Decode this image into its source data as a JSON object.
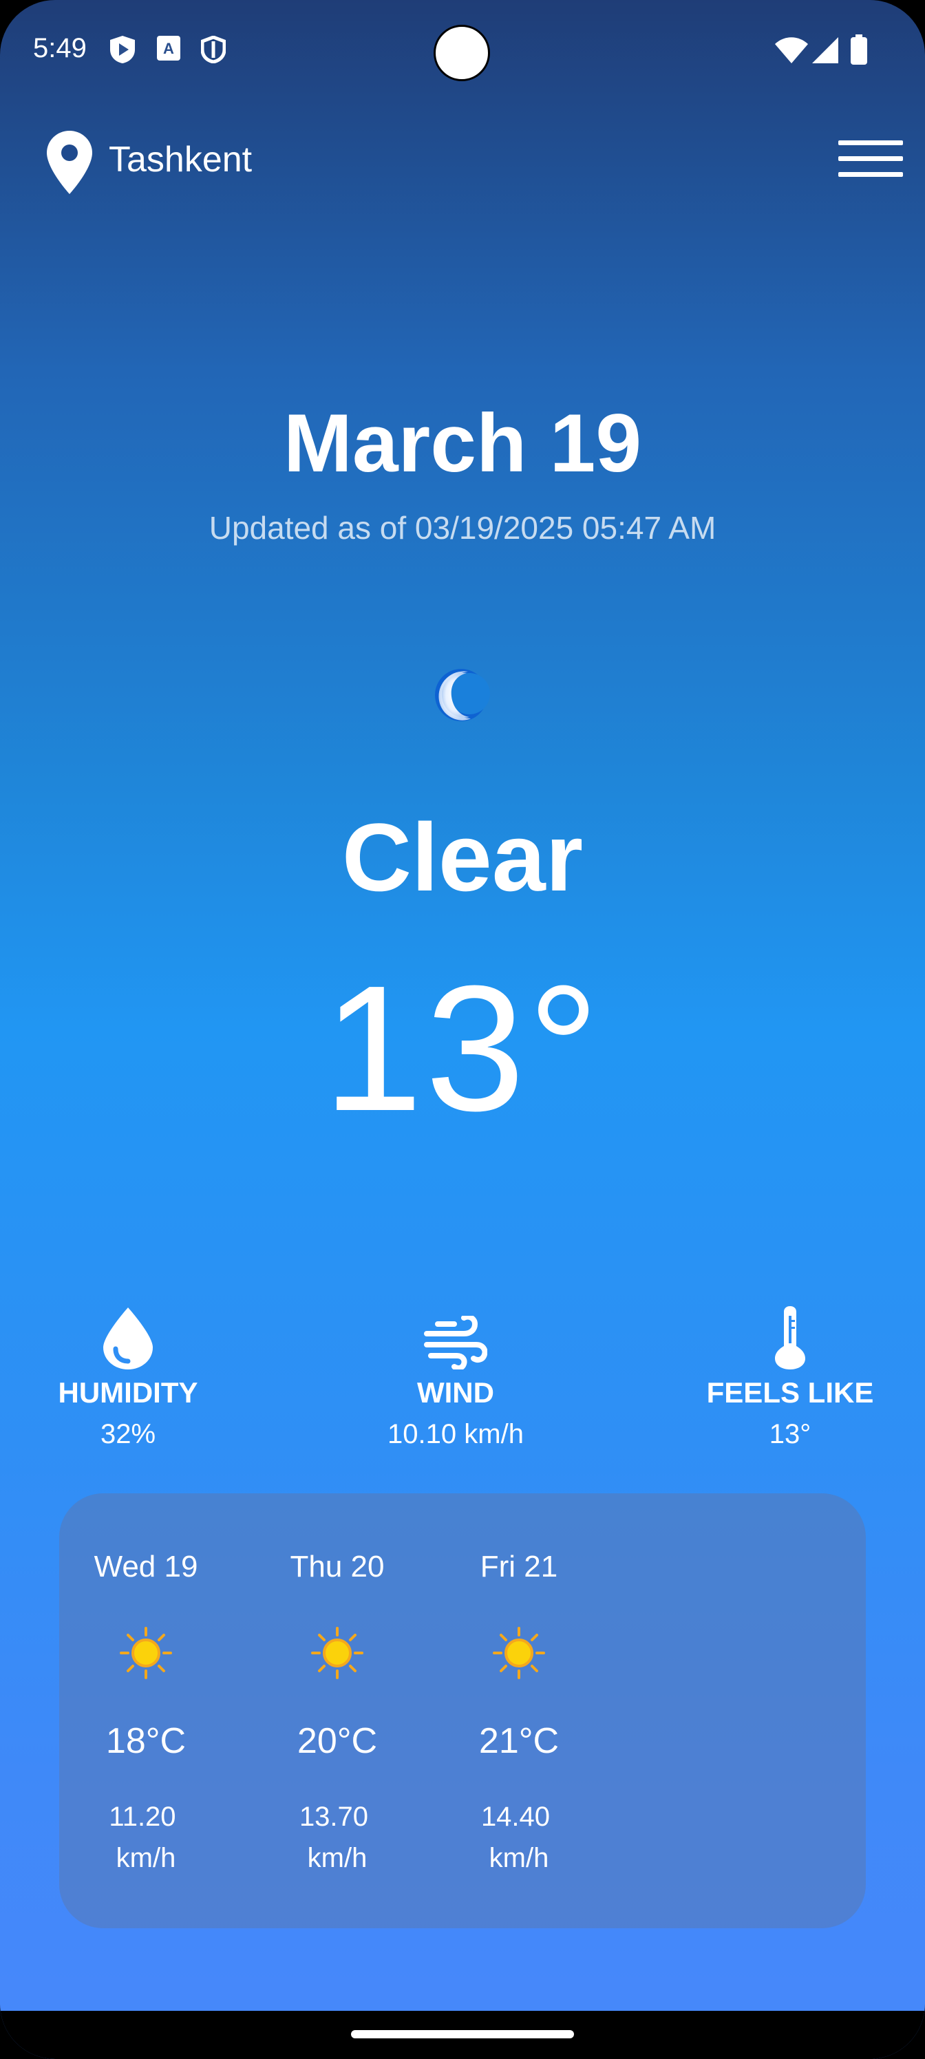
{
  "status_bar": {
    "time": "5:49",
    "icons": [
      "play-protect-icon",
      "keyboard-a-icon",
      "shield-icon",
      "wifi-icon",
      "signal-icon",
      "battery-icon"
    ]
  },
  "header": {
    "location": "Tashkent",
    "location_icon": "location-pin-icon",
    "menu_icon": "hamburger-menu-icon"
  },
  "main": {
    "date": "March 19",
    "updated": "Updated as of 03/19/2025 05:47 AM",
    "condition_icon": "crescent-moon-icon",
    "condition": "Clear",
    "temperature": "13°"
  },
  "metrics": [
    {
      "icon": "water-drop-icon",
      "label": "HUMIDITY",
      "value": "32%"
    },
    {
      "icon": "wind-icon",
      "label": "WIND",
      "value": "10.10 km/h"
    },
    {
      "icon": "thermometer-icon",
      "label": "FEELS LIKE",
      "value": "13°"
    }
  ],
  "forecast": [
    {
      "day": "Wed 19",
      "icon": "sun-icon",
      "temp": "18°C",
      "wind_value": "11.20",
      "wind_unit": "km/h"
    },
    {
      "day": "Thu 20",
      "icon": "sun-icon",
      "temp": "20°C",
      "wind_value": "13.70",
      "wind_unit": "km/h"
    },
    {
      "day": "Fri 21",
      "icon": "sun-icon",
      "temp": "21°C",
      "wind_value": "14.40",
      "wind_unit": "km/h"
    }
  ],
  "colors": {
    "gradient_top": "#1f3d77",
    "gradient_mid": "#2196f3",
    "gradient_bottom": "#4888fb",
    "sun": "#fbd20b",
    "sun_ray": "#f4a81d"
  }
}
